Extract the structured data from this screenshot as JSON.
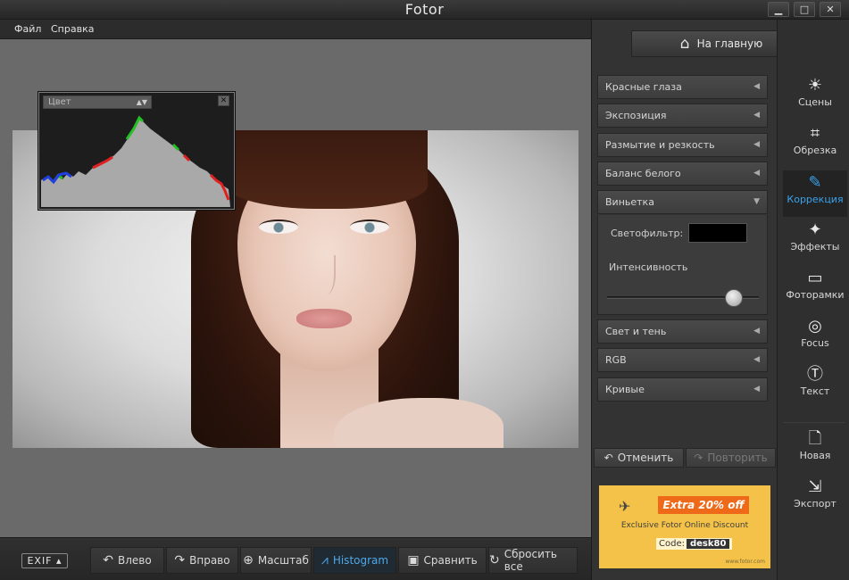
{
  "window": {
    "title": "Fotor",
    "controls": {
      "minimize": "▁",
      "maximize": "□",
      "close": "✕"
    }
  },
  "menu": {
    "items": [
      "Файл",
      "Справка"
    ]
  },
  "histogram": {
    "channel": "Цвет",
    "close": "✕"
  },
  "bottom_toolbar": {
    "exif": "EXIF ▴",
    "buttons": [
      {
        "label": "Влево",
        "icon": "rotate-left-icon"
      },
      {
        "label": "Вправо",
        "icon": "rotate-right-icon"
      },
      {
        "label": "Масштаб",
        "icon": "zoom-icon"
      },
      {
        "label": "Histogram",
        "icon": "histogram-icon",
        "active": true
      },
      {
        "label": "Сравнить",
        "icon": "compare-icon"
      },
      {
        "label": "Сбросить все",
        "icon": "reset-icon"
      }
    ]
  },
  "panel": {
    "home_label": "На главную",
    "sections": [
      {
        "label": "Красные глаза",
        "open": false
      },
      {
        "label": "Экспозиция",
        "open": false
      },
      {
        "label": "Размытие и резкость",
        "open": false
      },
      {
        "label": "Баланс белого",
        "open": false
      },
      {
        "label": "Виньетка",
        "open": true
      },
      {
        "label": "Свет и тень",
        "open": false
      },
      {
        "label": "RGB",
        "open": false
      },
      {
        "label": "Кривые",
        "open": false
      }
    ],
    "vignette": {
      "filter_label": "Светофильтр:",
      "filter_color": "#000000",
      "intensity_label": "Интенсивность",
      "intensity_value": 0.88
    },
    "undo_label": "Отменить",
    "redo_label": "Повторить"
  },
  "ad": {
    "offer": "Extra 20% off",
    "line": "Exclusive Fotor Online Discount",
    "code_label": "Code:",
    "code": "desk80",
    "site": "www.fotor.com"
  },
  "tools": [
    {
      "label": "Сцены",
      "icon": "sun-icon",
      "active": false
    },
    {
      "label": "Обрезка",
      "icon": "crop-icon",
      "active": false
    },
    {
      "label": "Коррекция",
      "icon": "pencil-icon",
      "active": true
    },
    {
      "label": "Эффекты",
      "icon": "sparkle-icon",
      "active": false
    },
    {
      "label": "Фоторамки",
      "icon": "frame-icon",
      "active": false
    },
    {
      "label": "Focus",
      "icon": "focus-icon",
      "active": false
    },
    {
      "label": "Текст",
      "icon": "text-icon",
      "active": false
    },
    {
      "label": "Новая",
      "icon": "new-file-icon",
      "active": false
    },
    {
      "label": "Экспорт",
      "icon": "export-icon",
      "active": false
    }
  ],
  "colors": {
    "accent": "#3aa2ec",
    "ad_background": "#f4c248",
    "ad_badge": "#ee6a18"
  }
}
